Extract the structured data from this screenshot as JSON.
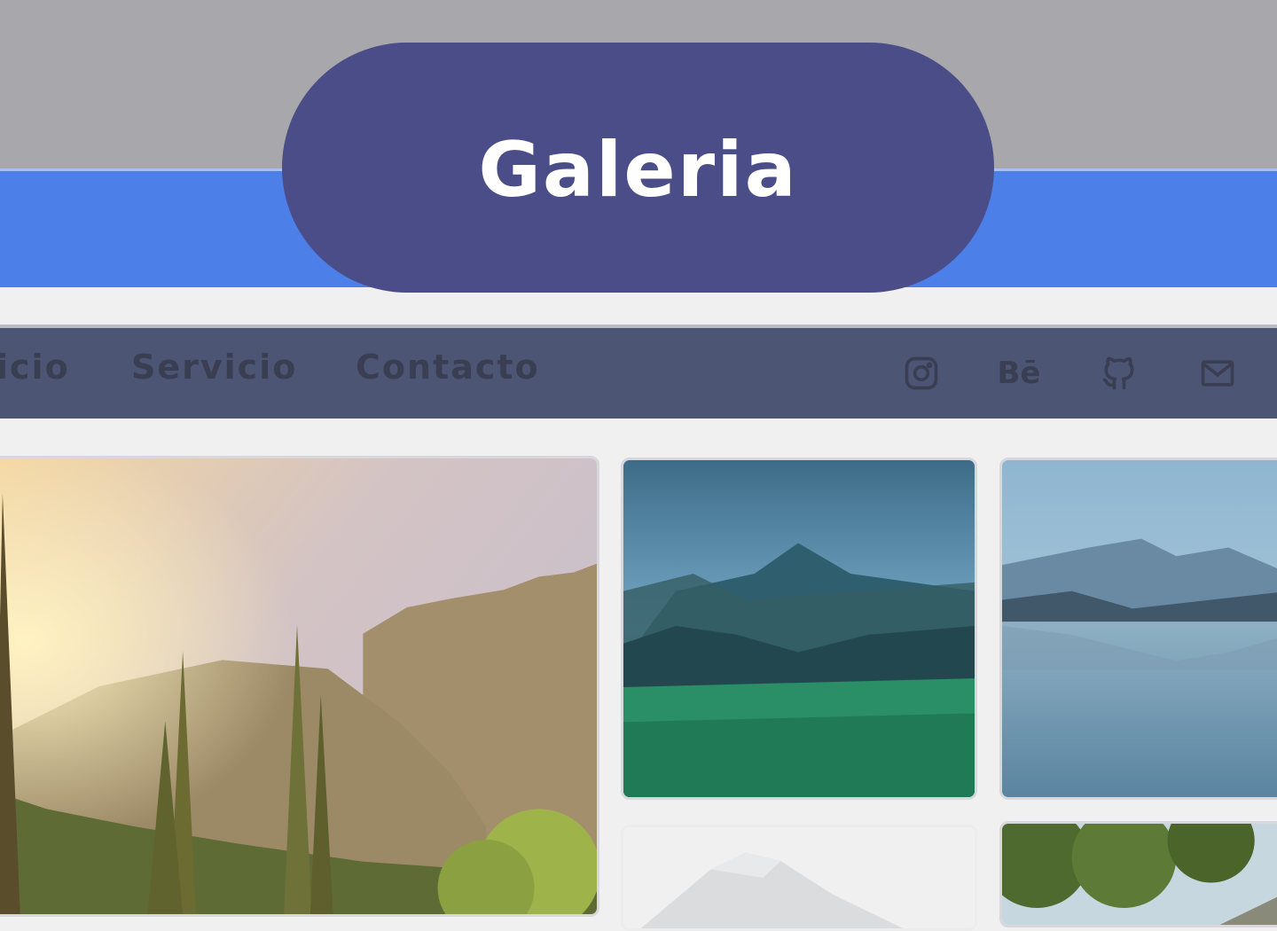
{
  "header": {
    "title": "Galeria"
  },
  "nav": {
    "links": [
      "icio",
      "Servicio",
      "Contacto"
    ]
  },
  "social": {
    "icons": [
      "instagram-icon",
      "behance-icon",
      "github-icon",
      "mail-icon"
    ],
    "behance_text": "Bē"
  },
  "colors": {
    "top_band": "#a8a8ac",
    "blue_band": "#4c80e8",
    "title_pill": "#4a4d88",
    "nav_bar": "#4d5575",
    "page_bg": "#f0f0f0"
  },
  "gallery": {
    "images": [
      "forest-sunrise-photo",
      "green-mountain-valley-photo",
      "mountain-lake-reflection-photo",
      "snowy-peak-photo",
      "tree-canopy-photo"
    ]
  }
}
